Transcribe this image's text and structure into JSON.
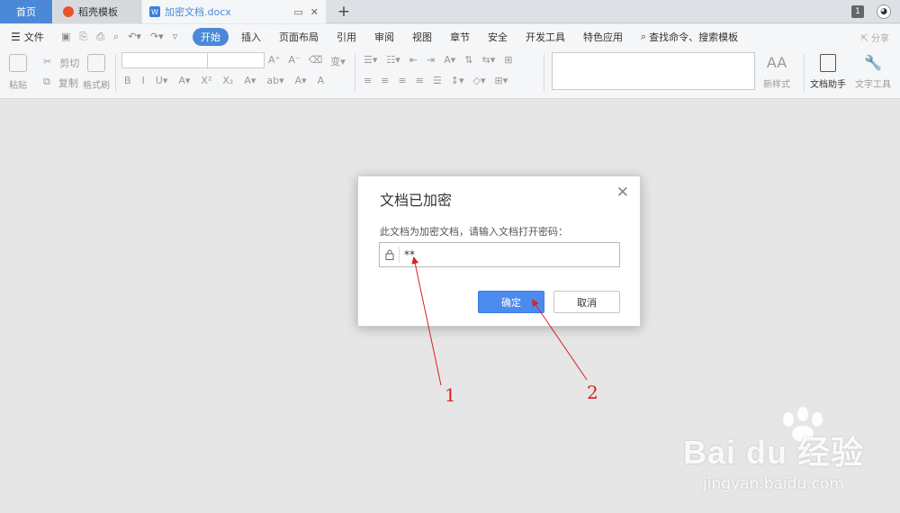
{
  "tabs": {
    "home": "首页",
    "template": "稻壳模板",
    "document": "加密文档.docx",
    "new_tab": "+",
    "account_badge": "1"
  },
  "menu": {
    "file": "文件",
    "items": [
      "开始",
      "插入",
      "页面布局",
      "引用",
      "审阅",
      "视图",
      "章节",
      "安全",
      "开发工具",
      "特色应用"
    ],
    "active": "开始",
    "search": "查找命令、搜索模板",
    "share": "分享"
  },
  "ribbon": {
    "paste": "粘贴",
    "cut": "剪切",
    "copy": "复制",
    "format_painter": "格式刷",
    "new_style": "新样式",
    "doc_helper": "文档助手",
    "text_tool": "文字工具"
  },
  "dialog": {
    "title": "文档已加密",
    "message": "此文档为加密文档，请输入文档打开密码：",
    "password_value": "**",
    "ok": "确定",
    "cancel": "取消"
  },
  "annotations": {
    "label_1": "1",
    "label_2": "2",
    "color": "#d62222"
  },
  "watermark": {
    "logo": "Bai du 经验",
    "url": "jingyan.baidu.com"
  },
  "colors": {
    "accent": "#4b89d8",
    "primary_button": "#4b8bf0"
  }
}
